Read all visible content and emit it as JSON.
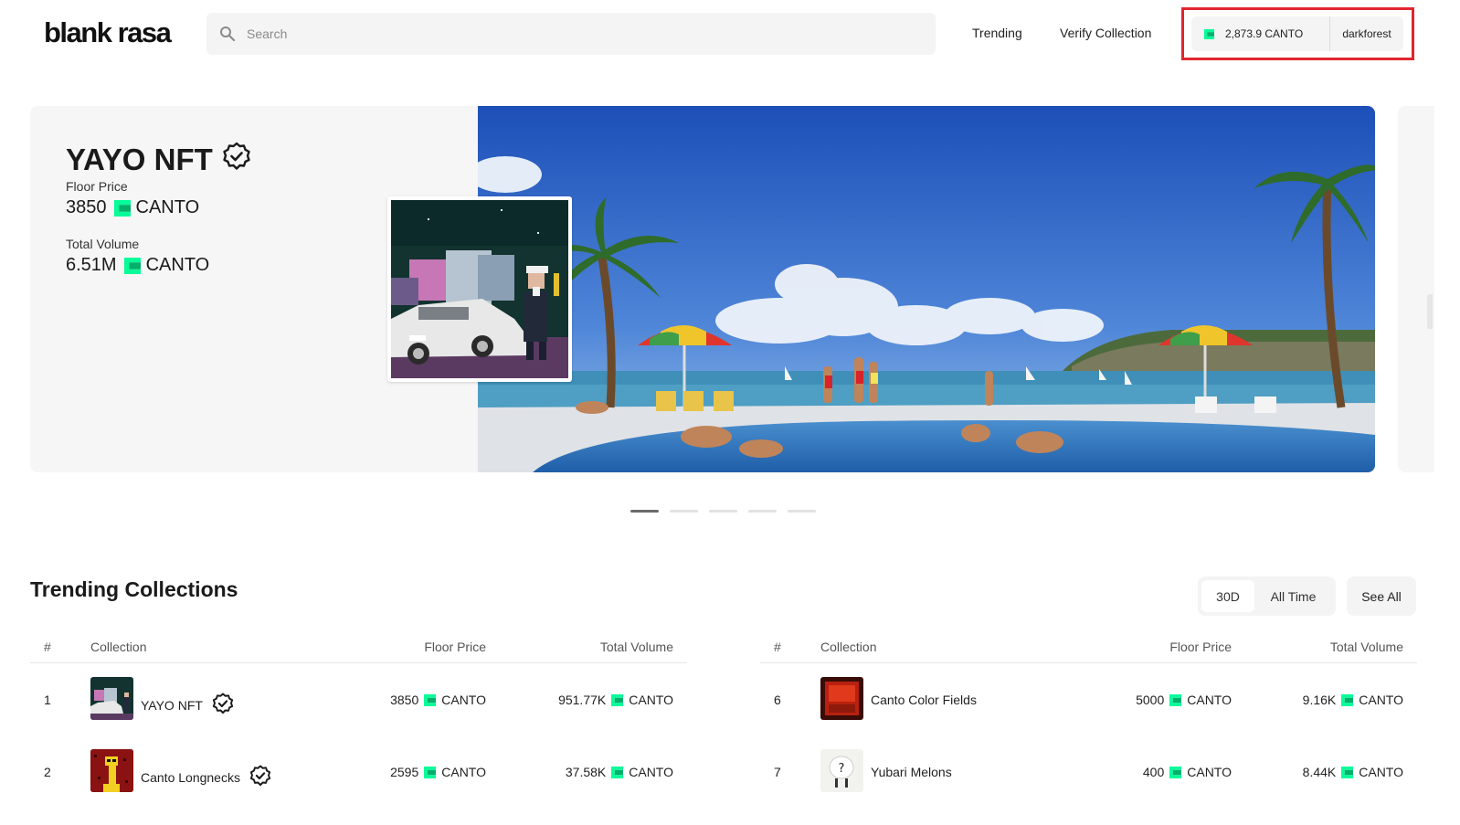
{
  "header": {
    "logo": "blank rasa",
    "search_placeholder": "Search",
    "nav": {
      "trending": "Trending",
      "verify": "Verify Collection"
    },
    "wallet": {
      "balance": "2,873.9 CANTO",
      "account": "darkforest"
    }
  },
  "hero": {
    "title": "YAYO NFT",
    "floor_label": "Floor Price",
    "floor_value": "3850",
    "floor_unit": "CANTO",
    "volume_label": "Total Volume",
    "volume_value": "6.51M",
    "volume_unit": "CANTO",
    "slides_total": 5,
    "active_slide": 1
  },
  "trending": {
    "title": "Trending Collections",
    "filters": [
      "30D",
      "All Time"
    ],
    "active_filter": "30D",
    "see_all": "See All",
    "columns": {
      "rank": "#",
      "collection": "Collection",
      "floor": "Floor Price",
      "volume": "Total Volume"
    },
    "left_rows": [
      {
        "rank": "1",
        "name": "YAYO NFT",
        "verified": true,
        "floor": "3850",
        "floor_unit": "CANTO",
        "volume": "951.77K",
        "volume_unit": "CANTO"
      },
      {
        "rank": "2",
        "name": "Canto Longnecks",
        "verified": true,
        "floor": "2595",
        "floor_unit": "CANTO",
        "volume": "37.58K",
        "volume_unit": "CANTO"
      }
    ],
    "right_rows": [
      {
        "rank": "6",
        "name": "Canto Color Fields",
        "verified": false,
        "floor": "5000",
        "floor_unit": "CANTO",
        "volume": "9.16K",
        "volume_unit": "CANTO"
      },
      {
        "rank": "7",
        "name": "Yubari Melons",
        "verified": false,
        "floor": "400",
        "floor_unit": "CANTO",
        "volume": "8.44K",
        "volume_unit": "CANTO"
      }
    ]
  },
  "colors": {
    "canto_green": "#06fc99",
    "highlight_red": "#e0262f",
    "panel_gray": "#f6f6f6"
  }
}
